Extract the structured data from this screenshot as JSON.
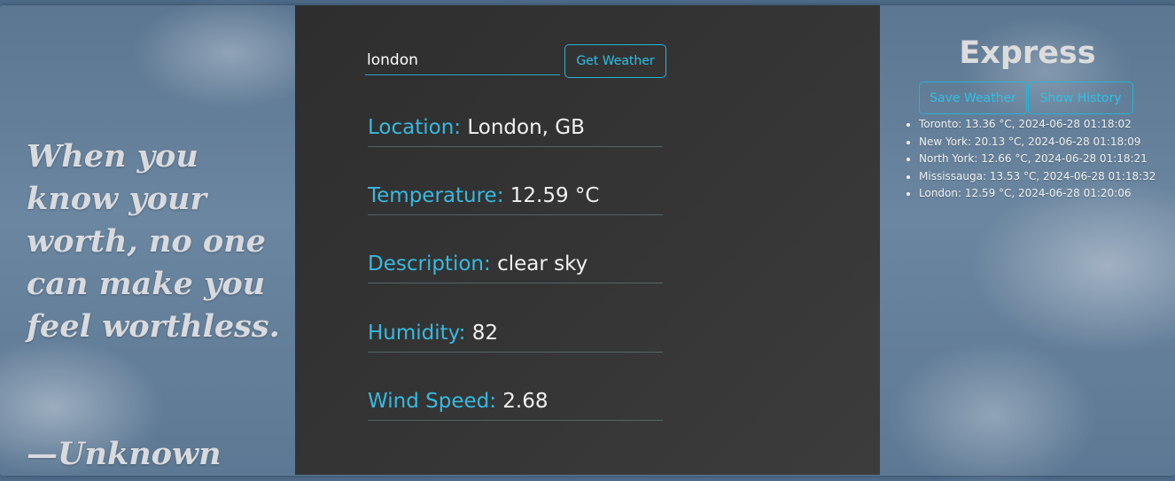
{
  "quote": {
    "text": "When you know your worth, no one can make you feel worthless.",
    "author": "—Unknown"
  },
  "search": {
    "value": "london",
    "button_label": "Get Weather"
  },
  "weather": {
    "location": {
      "label": "Location:",
      "value": "London, GB"
    },
    "temperature": {
      "label": "Temperature:",
      "value": "12.59 °C"
    },
    "description": {
      "label": "Description:",
      "value": "clear sky"
    },
    "humidity": {
      "label": "Humidity:",
      "value": "82"
    },
    "wind_speed": {
      "label": "Wind Speed:",
      "value": "2.68"
    }
  },
  "sidebar": {
    "title": "Express",
    "save_label": "Save Weather",
    "history_label": "Show History",
    "history": [
      "Toronto: 13.36 °C, 2024-06-28 01:18:02",
      "New York: 20.13 °C, 2024-06-28 01:18:09",
      "North York: 12.66 °C, 2024-06-28 01:18:21",
      "Mississauga: 13.53 °C, 2024-06-28 01:18:32",
      "London: 12.59 °C, 2024-06-28 01:20:06"
    ]
  },
  "colors": {
    "accent": "#2fc0e6",
    "panel": "#333333",
    "label": "#38b9e0"
  }
}
